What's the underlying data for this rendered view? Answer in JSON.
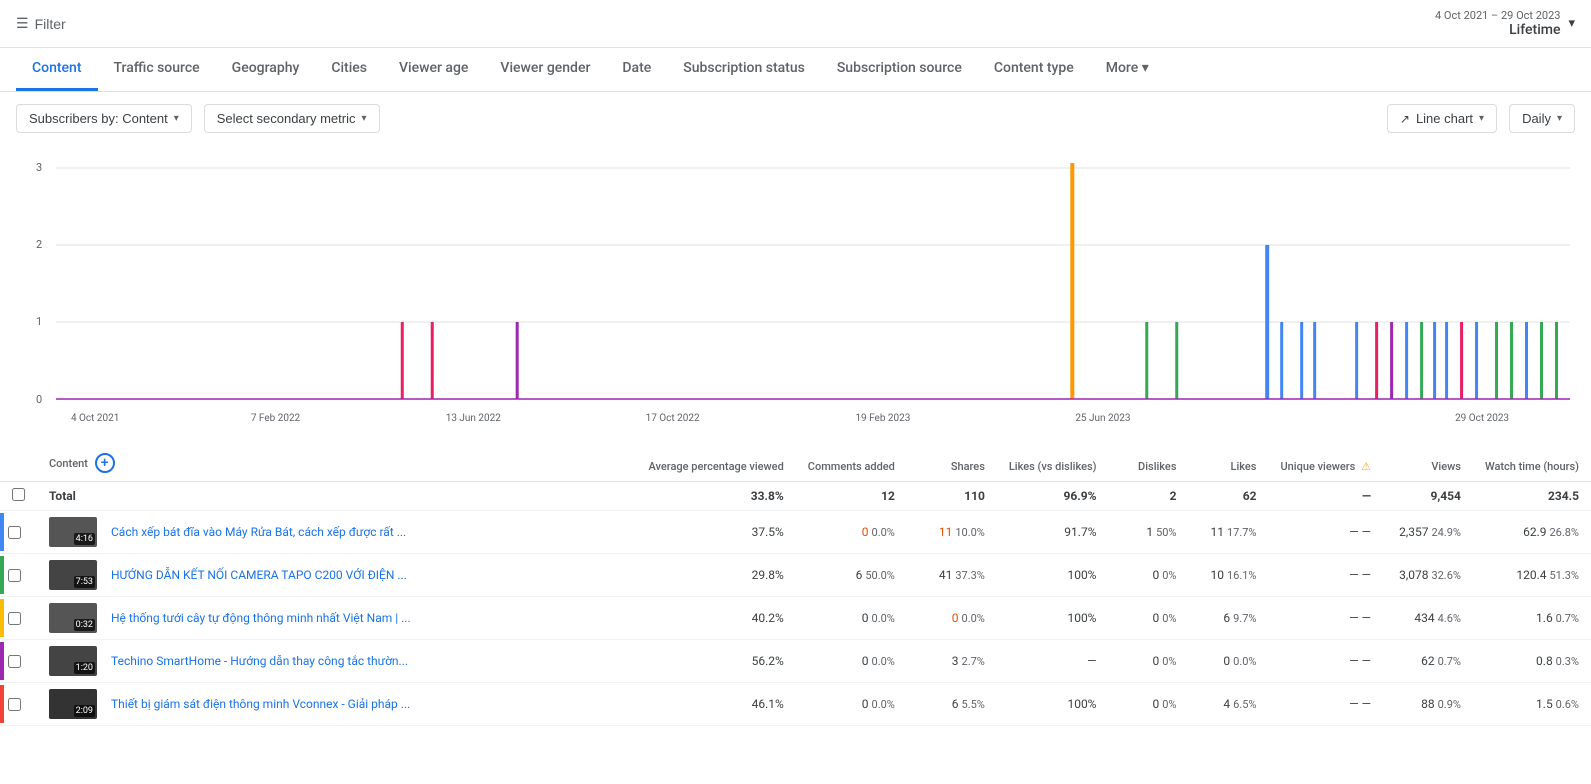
{
  "header": {
    "filter_label": "Filter",
    "date_range": "4 Oct 2021 – 29 Oct 2023",
    "lifetime": "Lifetime"
  },
  "tabs": [
    {
      "id": "content",
      "label": "Content",
      "active": true
    },
    {
      "id": "traffic-source",
      "label": "Traffic source",
      "active": false
    },
    {
      "id": "geography",
      "label": "Geography",
      "active": false
    },
    {
      "id": "cities",
      "label": "Cities",
      "active": false
    },
    {
      "id": "viewer-age",
      "label": "Viewer age",
      "active": false
    },
    {
      "id": "viewer-gender",
      "label": "Viewer gender",
      "active": false
    },
    {
      "id": "date",
      "label": "Date",
      "active": false
    },
    {
      "id": "subscription-status",
      "label": "Subscription status",
      "active": false
    },
    {
      "id": "subscription-source",
      "label": "Subscription source",
      "active": false
    },
    {
      "id": "content-type",
      "label": "Content type",
      "active": false
    },
    {
      "id": "more",
      "label": "More",
      "active": false
    }
  ],
  "toolbar": {
    "primary_metric": "Subscribers by: Content",
    "secondary_metric": "Select secondary metric",
    "chart_type": "Line chart",
    "period": "Daily"
  },
  "chart": {
    "y_labels": [
      "3",
      "2",
      "1",
      "0"
    ],
    "x_labels": [
      "4 Oct 2021",
      "7 Feb 2022",
      "13 Jun 2022",
      "17 Oct 2022",
      "19 Feb 2023",
      "25 Jun 2023",
      "29 Oct 2023"
    ]
  },
  "table": {
    "columns": [
      {
        "id": "content",
        "label": "Content",
        "align": "left"
      },
      {
        "id": "avg_pct_viewed",
        "label": "Average percentage viewed",
        "align": "right"
      },
      {
        "id": "comments_added",
        "label": "Comments added",
        "align": "right"
      },
      {
        "id": "shares",
        "label": "Shares",
        "align": "right"
      },
      {
        "id": "likes_vs_dislikes",
        "label": "Likes (vs dislikes)",
        "align": "right"
      },
      {
        "id": "dislikes",
        "label": "Dislikes",
        "align": "right"
      },
      {
        "id": "likes",
        "label": "Likes",
        "align": "right"
      },
      {
        "id": "unique_viewers",
        "label": "Unique viewers",
        "align": "right"
      },
      {
        "id": "views",
        "label": "Views",
        "align": "right"
      },
      {
        "id": "watch_time",
        "label": "Watch time (hours)",
        "align": "right"
      }
    ],
    "total": {
      "label": "Total",
      "avg_pct_viewed": "33.8%",
      "comments_added": "12",
      "shares": "110",
      "likes_vs_dislikes": "96.9%",
      "dislikes": "2",
      "likes": "62",
      "unique_viewers": "—",
      "views": "9,454",
      "watch_time": "234.5"
    },
    "rows": [
      {
        "color": "#4285f4",
        "duration": "4:16",
        "title": "Cách xếp bát đĩa vào Máy Rửa Bát, cách xếp được rất ...",
        "avg_pct_viewed": "37.5%",
        "comments": "0",
        "comments_pct": "0.0%",
        "shares": "11",
        "shares_pct": "10.0%",
        "likes_vs_dislikes": "91.7%",
        "dislikes": "1",
        "dislikes_pct": "50%",
        "likes": "11",
        "likes_pct": "17.7%",
        "unique_1": "—",
        "unique_2": "—",
        "views": "2,357",
        "views_pct": "24.9%",
        "watch_time": "62.9",
        "watch_time_pct": "26.8%"
      },
      {
        "color": "#34a853",
        "duration": "7:53",
        "title": "HƯỚNG DẪN KẾT NỐI CAMERA TAPO C200 VỚI ĐIỆN ...",
        "avg_pct_viewed": "29.8%",
        "comments": "6",
        "comments_pct": "50.0%",
        "shares": "41",
        "shares_pct": "37.3%",
        "likes_vs_dislikes": "100%",
        "dislikes": "0",
        "dislikes_pct": "0%",
        "likes": "10",
        "likes_pct": "16.1%",
        "unique_1": "—",
        "unique_2": "—",
        "views": "3,078",
        "views_pct": "32.6%",
        "watch_time": "120.4",
        "watch_time_pct": "51.3%"
      },
      {
        "color": "#fbbc04",
        "duration": "0:32",
        "title": "Hệ thống tưới cây tự động thông minh nhất Việt Nam | ...",
        "avg_pct_viewed": "40.2%",
        "comments": "0",
        "comments_pct": "0.0%",
        "shares": "0",
        "shares_pct": "0.0%",
        "likes_vs_dislikes": "100%",
        "dislikes": "0",
        "dislikes_pct": "0%",
        "likes": "6",
        "likes_pct": "9.7%",
        "unique_1": "—",
        "unique_2": "—",
        "views": "434",
        "views_pct": "4.6%",
        "watch_time": "1.6",
        "watch_time_pct": "0.7%"
      },
      {
        "color": "#9c27b0",
        "duration": "1:20",
        "title": "Techino SmartHome - Hướng dẫn thay công tắc thườn...",
        "avg_pct_viewed": "56.2%",
        "comments": "0",
        "comments_pct": "0.0%",
        "shares": "3",
        "shares_pct": "2.7%",
        "likes_vs_dislikes": "—",
        "dislikes": "0",
        "dislikes_pct": "0%",
        "likes": "0",
        "likes_pct": "0.0%",
        "unique_1": "—",
        "unique_2": "—",
        "views": "62",
        "views_pct": "0.7%",
        "watch_time": "0.8",
        "watch_time_pct": "0.3%"
      },
      {
        "color": "#f44336",
        "duration": "2:09",
        "title": "Thiết bị giám sát điện thông minh Vconnex - Giải pháp ...",
        "avg_pct_viewed": "46.1%",
        "comments": "0",
        "comments_pct": "0.0%",
        "shares": "6",
        "shares_pct": "5.5%",
        "likes_vs_dislikes": "100%",
        "dislikes": "0",
        "dislikes_pct": "0%",
        "likes": "4",
        "likes_pct": "6.5%",
        "unique_1": "—",
        "unique_2": "—",
        "views": "88",
        "views_pct": "0.9%",
        "watch_time": "1.5",
        "watch_time_pct": "0.6%"
      }
    ]
  }
}
